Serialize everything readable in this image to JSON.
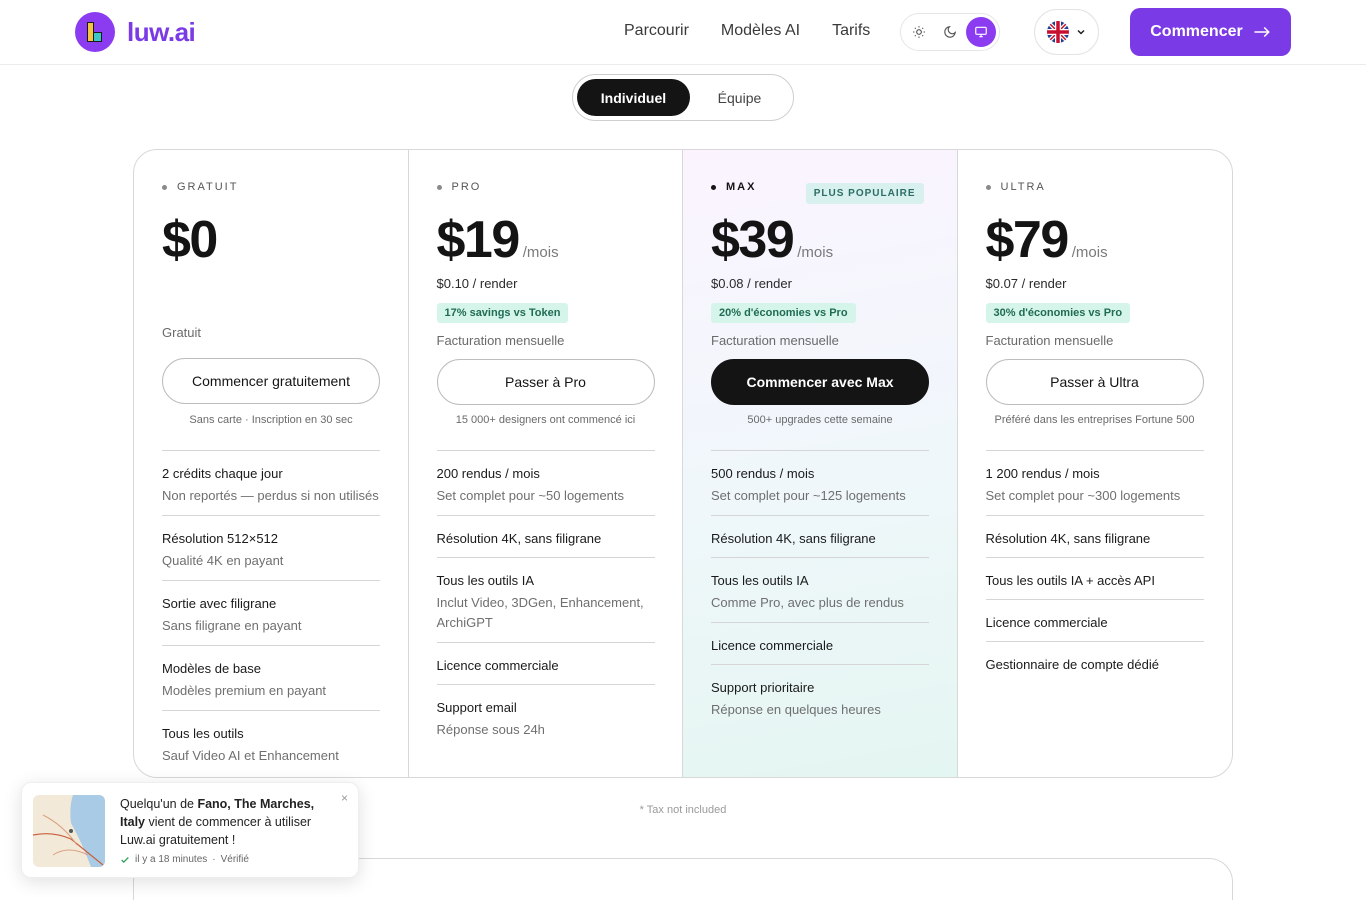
{
  "header": {
    "logo_text": "luw.ai",
    "nav": [
      "Parcourir",
      "Modèles AI",
      "Tarifs"
    ],
    "cta_label": "Commencer",
    "brand_color": "#7a3ae6"
  },
  "toggle": {
    "active": "Individuel",
    "inactive": "Équipe"
  },
  "plans": [
    {
      "tier": "GRATUIT",
      "price": "$0",
      "billing": "Gratuit",
      "button": "Commencer gratuitement",
      "subnote": "Sans carte · Inscription en 30 sec",
      "features": [
        {
          "t": "2 crédits chaque jour",
          "s": "Non reportés — perdus si non utilisés"
        },
        {
          "t": "Résolution 512×512",
          "s": "Qualité 4K en payant"
        },
        {
          "t": "Sortie avec filigrane",
          "s": "Sans filigrane en payant"
        },
        {
          "t": "Modèles de base",
          "s": "Modèles premium en payant"
        },
        {
          "t": "Tous les outils",
          "s": "Sauf Video AI et Enhancement"
        }
      ]
    },
    {
      "tier": "PRO",
      "price": "$19",
      "per": "/mois",
      "render": "$0.10 / render",
      "saving": "17% savings vs Token",
      "billing": "Facturation mensuelle",
      "button": "Passer à Pro",
      "subnote": "15 000+ designers ont commencé ici",
      "features": [
        {
          "t": "200 rendus / mois",
          "s": "Set complet pour ~50 logements"
        },
        {
          "t": "Résolution 4K, sans filigrane"
        },
        {
          "t": "Tous les outils IA",
          "s": "Inclut Video, 3DGen, Enhancement, ArchiGPT"
        },
        {
          "t": "Licence commerciale"
        },
        {
          "t": "Support email",
          "s": "Réponse sous 24h"
        }
      ]
    },
    {
      "tier": "MAX",
      "badge": "PLUS POPULAIRE",
      "price": "$39",
      "per": "/mois",
      "render": "$0.08 / render",
      "saving": "20% d'économies vs Pro",
      "billing": "Facturation mensuelle",
      "button": "Commencer avec Max",
      "subnote": "500+ upgrades cette semaine",
      "features": [
        {
          "t": "500 rendus / mois",
          "s": "Set complet pour ~125 logements"
        },
        {
          "t": "Résolution 4K, sans filigrane"
        },
        {
          "t": "Tous les outils IA",
          "s": "Comme Pro, avec plus de rendus"
        },
        {
          "t": "Licence commerciale"
        },
        {
          "t": "Support prioritaire",
          "s": "Réponse en quelques heures"
        }
      ]
    },
    {
      "tier": "ULTRA",
      "price": "$79",
      "per": "/mois",
      "render": "$0.07 / render",
      "saving": "30% d'économies vs Pro",
      "billing": "Facturation mensuelle",
      "button": "Passer à Ultra",
      "subnote": "Préféré dans les entreprises Fortune 500",
      "features": [
        {
          "t": "1 200 rendus / mois",
          "s": "Set complet pour ~300 logements"
        },
        {
          "t": "Résolution 4K, sans filigrane"
        },
        {
          "t": "Tous les outils IA + accès API"
        },
        {
          "t": "Licence commerciale"
        },
        {
          "t": "Gestionnaire de compte dédié"
        }
      ]
    }
  ],
  "tax_note": "* Tax not included",
  "toast": {
    "prefix": "Quelqu'un de ",
    "location": "Fano, The Marches, Italy",
    "suffix": " vient de commencer à utiliser Luw.ai gratuitement !",
    "time": "il y a 18 minutes",
    "separator": "·",
    "verified": "Vérifié"
  }
}
